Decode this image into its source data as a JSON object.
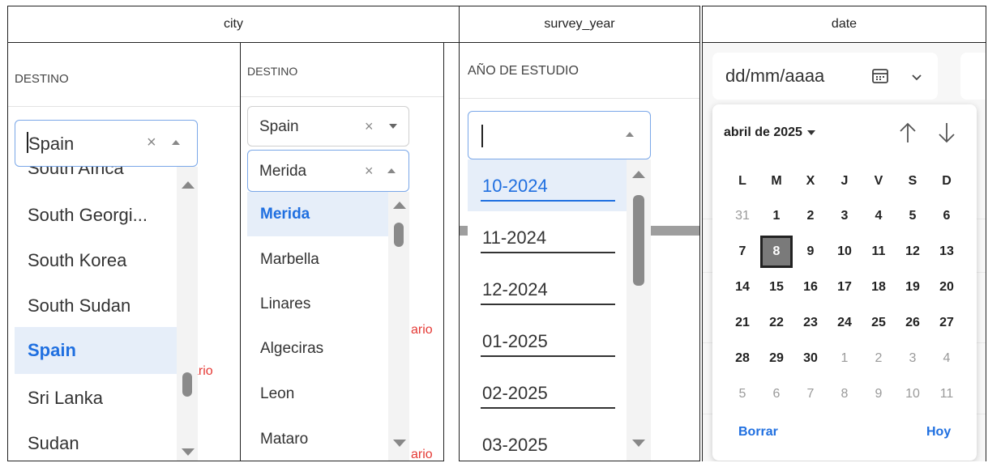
{
  "headers": {
    "city": "city",
    "survey_year": "survey_year",
    "date": "date"
  },
  "panel1": {
    "label": "DESTINO",
    "input_value": "Spain",
    "clear_glyph": "×",
    "cut_item": "South Africa",
    "items": [
      "South Georgi...",
      "South Korea",
      "South Sudan",
      "Spain",
      "Sri Lanka",
      "Sudan"
    ],
    "selected": "Spain",
    "bg_fragment": "ario"
  },
  "panel2": {
    "label": "DESTINO",
    "country_value": "Spain",
    "city_value": "Merida",
    "clear_glyph": "×",
    "items": [
      "Merida",
      "Marbella",
      "Linares",
      "Algeciras",
      "Leon",
      "Mataro"
    ],
    "selected": "Merida",
    "bg_fragment_1": "ario",
    "bg_fragment_2": "ario"
  },
  "panel3": {
    "label": "AÑO DE ESTUDIO",
    "input_value": "",
    "items": [
      "10-2024",
      "11-2024",
      "12-2024",
      "01-2025",
      "02-2025",
      "03-2025"
    ],
    "selected": "10-2024"
  },
  "panel4": {
    "placeholder": "dd/mm/aaaa",
    "month_label": "abril de 2025",
    "weekdays": [
      "L",
      "M",
      "X",
      "J",
      "V",
      "S",
      "D"
    ],
    "weeks": [
      [
        "31",
        "1",
        "2",
        "3",
        "4",
        "5",
        "6"
      ],
      [
        "7",
        "8",
        "9",
        "10",
        "11",
        "12",
        "13"
      ],
      [
        "14",
        "15",
        "16",
        "17",
        "18",
        "19",
        "20"
      ],
      [
        "21",
        "22",
        "23",
        "24",
        "25",
        "26",
        "27"
      ],
      [
        "28",
        "29",
        "30",
        "1",
        "2",
        "3",
        "4"
      ],
      [
        "5",
        "6",
        "7",
        "8",
        "9",
        "10",
        "11"
      ]
    ],
    "selected_day": "8",
    "clear_label": "Borrar",
    "today_label": "Hoy"
  },
  "colors": {
    "accent": "#1f6fe0",
    "selected_bg": "#e6eef9",
    "error": "#e53935"
  }
}
